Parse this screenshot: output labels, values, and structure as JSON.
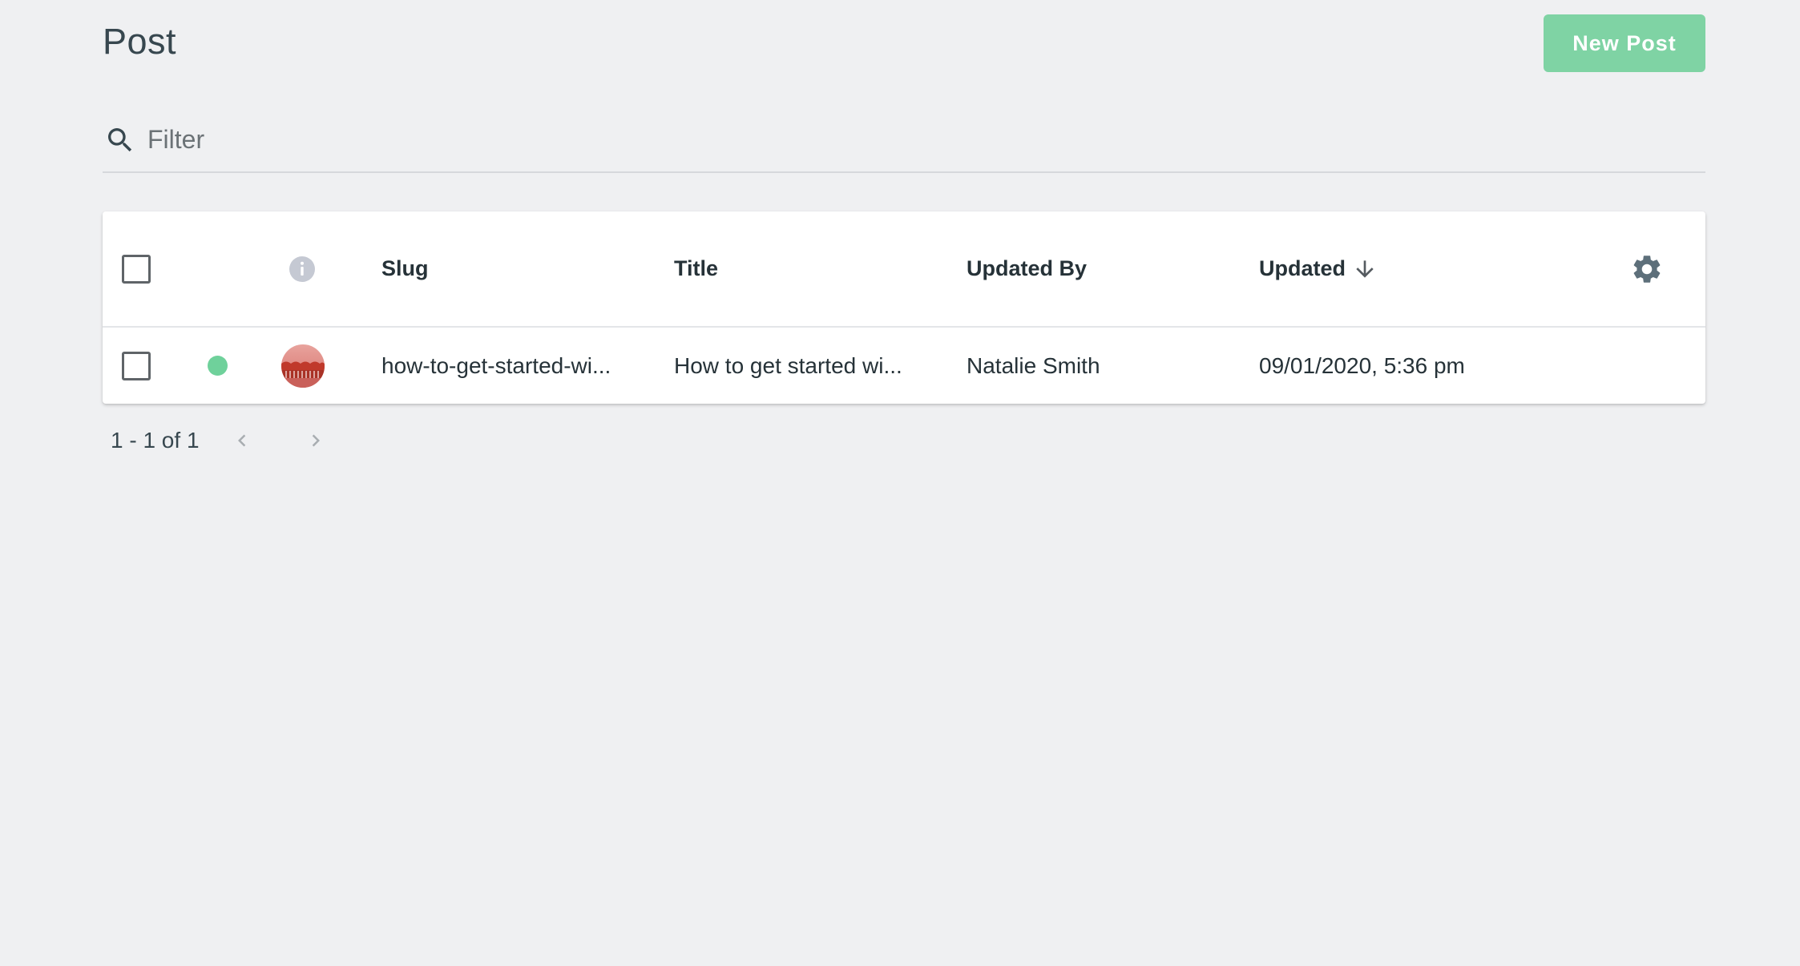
{
  "header": {
    "title": "Post",
    "new_button_label": "New Post"
  },
  "filter": {
    "placeholder": "Filter",
    "value": ""
  },
  "table": {
    "columns": {
      "info_icon": "info-icon",
      "slug": "Slug",
      "title": "Title",
      "updated_by": "Updated By",
      "updated": "Updated",
      "sort_direction": "descending"
    },
    "rows": [
      {
        "status": "published",
        "status_color": "#6fd19b",
        "slug": "how-to-get-started-wi...",
        "title": "How to get started wi...",
        "updated_by": "Natalie Smith",
        "updated": "09/01/2020, 5:36 pm"
      }
    ]
  },
  "pagination": {
    "label": "1 - 1 of 1"
  },
  "colors": {
    "accent": "#7fd3a4",
    "background": "#eff0f2",
    "status_published": "#6fd19b"
  }
}
